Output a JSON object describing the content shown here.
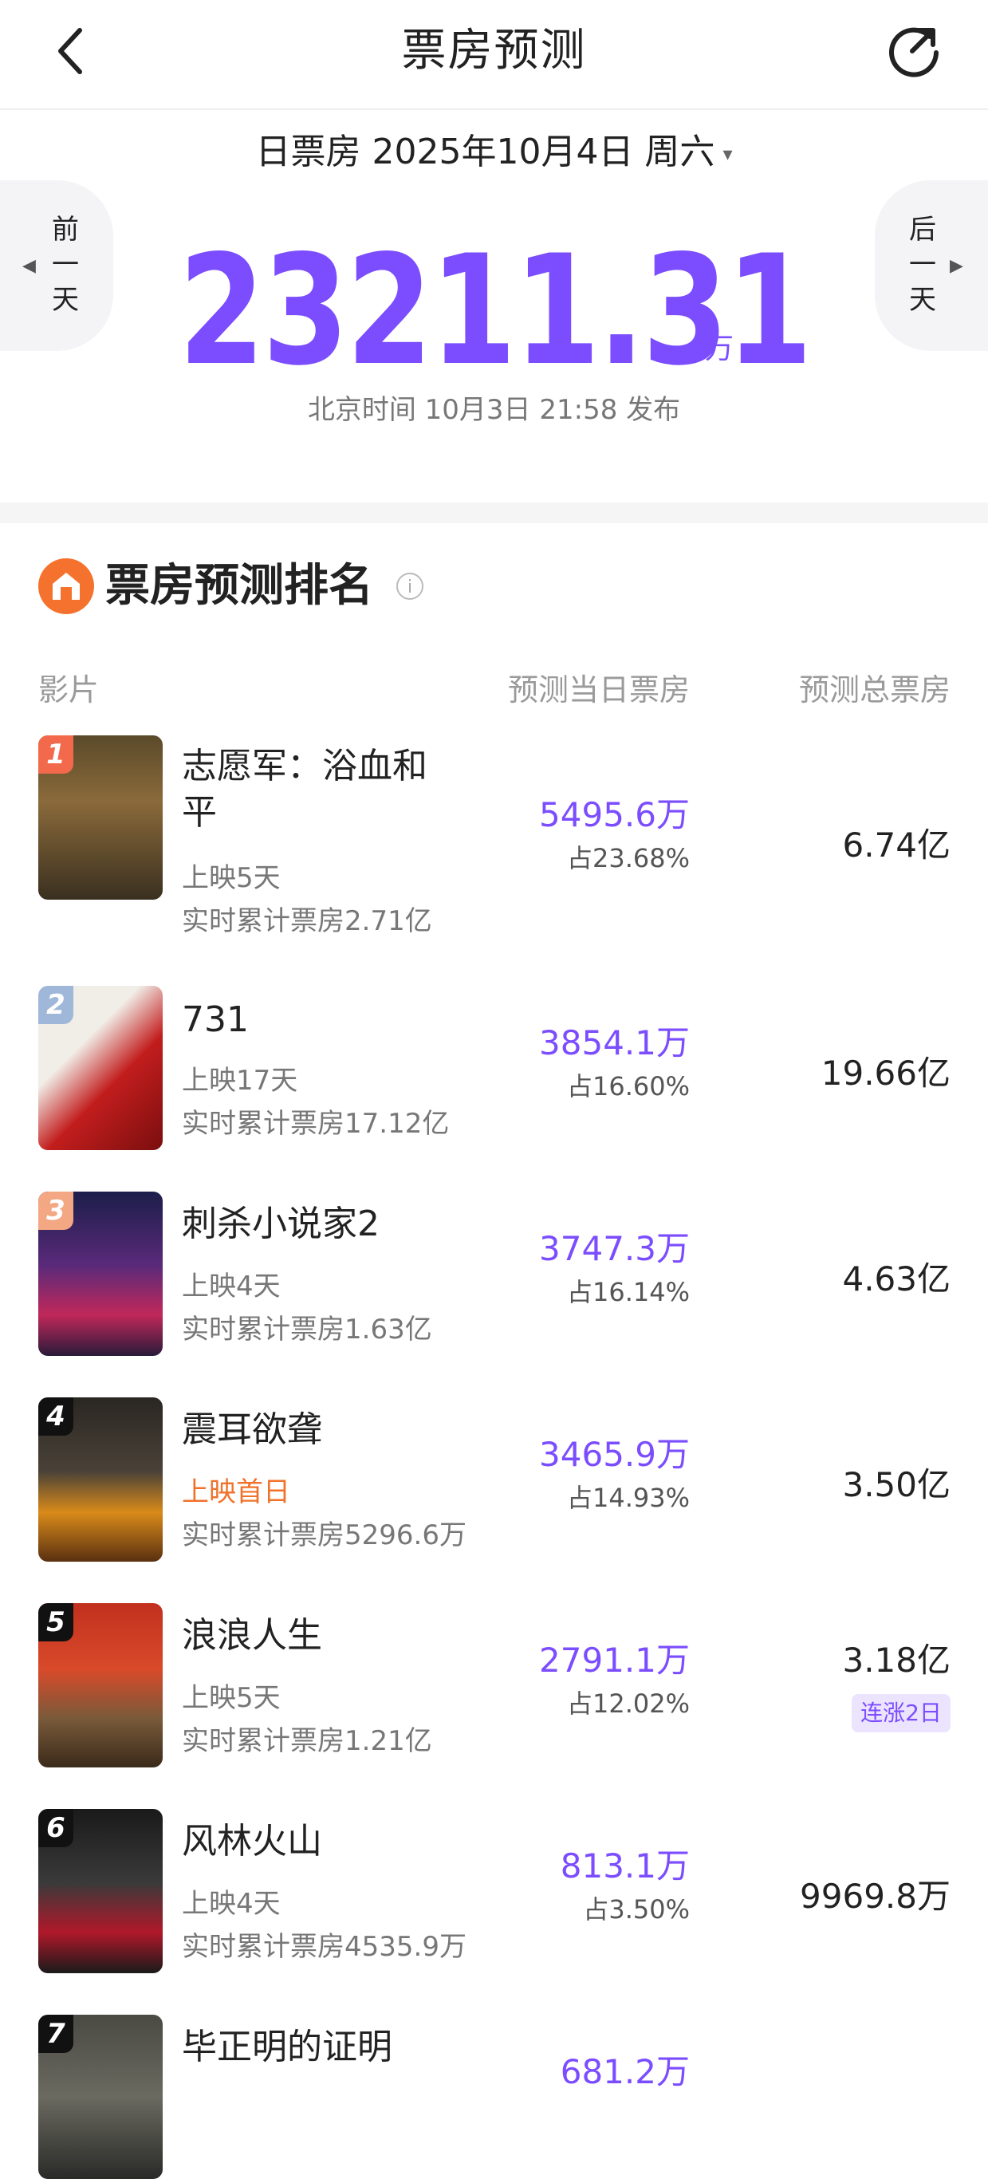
{
  "header": {
    "title": "票房预测",
    "back_icon": "chevron-left-icon",
    "share_icon": "share-refresh-icon"
  },
  "date_selector": {
    "label": "日票房 2025年10月4日 周六",
    "caret": "▾"
  },
  "nav": {
    "prev_label": "前一天",
    "next_label": "后一天",
    "prev_arrow": "◀",
    "next_arrow": "▶"
  },
  "summary": {
    "total": "23211.31",
    "unit": "万",
    "publish_time": "北京时间 10月3日 21:58 发布"
  },
  "ranking": {
    "title": "票房预测排名",
    "info_icon": "i",
    "columns": {
      "film": "影片",
      "day": "预测当日票房",
      "total": "预测总票房"
    },
    "films": [
      {
        "rank": "1",
        "title": "志愿军：浴血和平",
        "meta1": "上映5天",
        "meta2": "实时累计票房2.71亿",
        "day": "5495.6万",
        "share": "占23.68%",
        "total": "6.74亿",
        "badge": ""
      },
      {
        "rank": "2",
        "title": "731",
        "meta1": "上映17天",
        "meta2": "实时累计票房17.12亿",
        "day": "3854.1万",
        "share": "占16.60%",
        "total": "19.66亿",
        "badge": ""
      },
      {
        "rank": "3",
        "title": "刺杀小说家2",
        "meta1": "上映4天",
        "meta2": "实时累计票房1.63亿",
        "day": "3747.3万",
        "share": "占16.14%",
        "total": "4.63亿",
        "badge": ""
      },
      {
        "rank": "4",
        "title": "震耳欲聋",
        "meta1": "上映首日",
        "meta2": "实时累计票房5296.6万",
        "day": "3465.9万",
        "share": "占14.93%",
        "total": "3.50亿",
        "badge": ""
      },
      {
        "rank": "5",
        "title": "浪浪人生",
        "meta1": "上映5天",
        "meta2": "实时累计票房1.21亿",
        "day": "2791.1万",
        "share": "占12.02%",
        "total": "3.18亿",
        "badge": "连涨2日"
      },
      {
        "rank": "6",
        "title": "风林火山",
        "meta1": "上映4天",
        "meta2": "实时累计票房4535.9万",
        "day": "813.1万",
        "share": "占3.50%",
        "total": "9969.8万",
        "badge": ""
      },
      {
        "rank": "7",
        "title": "毕正明的证明",
        "meta1": "",
        "meta2": "",
        "day": "681.2万",
        "share": "",
        "total": "",
        "badge": ""
      }
    ]
  },
  "colors": {
    "accent": "#7b4dff",
    "new_release": "#f0722a",
    "rank1": "#f26a4b",
    "rank2": "#9fb8d9",
    "rank3": "#f3a783",
    "rank_other": "#111111"
  }
}
